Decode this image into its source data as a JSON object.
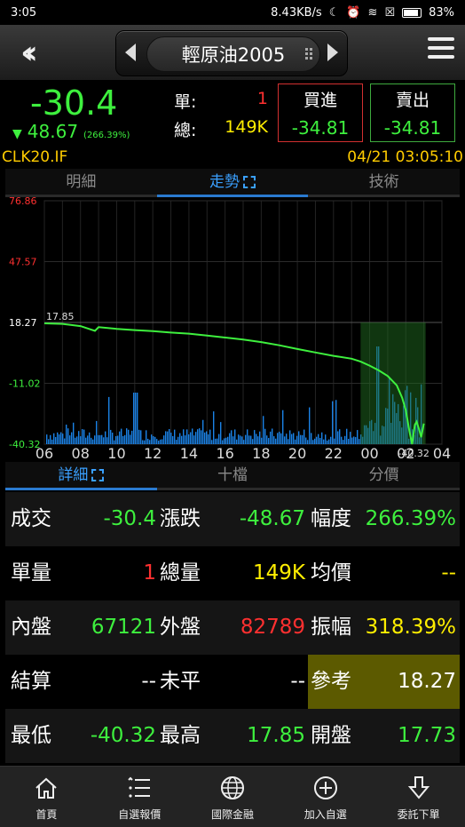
{
  "status_bar": {
    "time": "3:05",
    "network_speed": "8.43KB/s",
    "battery": "83%"
  },
  "nav": {
    "title": "輕原油2005"
  },
  "quote": {
    "last": "-30.4",
    "change": "48.67",
    "change_pct": "(266.39%)",
    "unit_label": "單:",
    "unit_value": "1",
    "total_label": "總:",
    "total_value": "149K",
    "buy_label": "買進",
    "buy_value": "-34.81",
    "sell_label": "賣出",
    "sell_value": "-34.81"
  },
  "info": {
    "code": "CLK20.IF",
    "datetime": "04/21 03:05:10"
  },
  "top_tabs": [
    "明細",
    "走勢",
    "技術"
  ],
  "chart_data": {
    "type": "line",
    "y_ticks": [
      "76.86",
      "47.57",
      "18.27",
      "-11.02",
      "-40.32"
    ],
    "y_tick_colors": [
      "#ff3030",
      "#ff3030",
      "#ffffff",
      "#3ef03e",
      "#3ef03e"
    ],
    "x_ticks": [
      "06",
      "08",
      "10",
      "12",
      "14",
      "16",
      "18",
      "20",
      "22",
      "00",
      "02",
      "04"
    ],
    "ylim": [
      -40.32,
      76.86
    ],
    "reference": 18.27,
    "high_label": "17.85",
    "low_label": "-40.32",
    "price": {
      "x": [
        0,
        1,
        2,
        2.8,
        3,
        4,
        5,
        6,
        7,
        8,
        9,
        10,
        11,
        12,
        13,
        14,
        15,
        16,
        17,
        17.5,
        18,
        18.5,
        19,
        19.5,
        19.8,
        20,
        20.2,
        20.35,
        20.5,
        20.6,
        20.75,
        20.85,
        21.0
      ],
      "y": [
        17.85,
        17.6,
        16.5,
        14.2,
        16.0,
        15.2,
        14.6,
        14.1,
        13.4,
        12.9,
        12.0,
        11.0,
        10.0,
        8.8,
        7.3,
        5.5,
        3.8,
        2.2,
        0.8,
        -0.6,
        -2.5,
        -4.8,
        -7.5,
        -12.0,
        -18.0,
        -24.0,
        -34.0,
        -40.32,
        -31.0,
        -29.5,
        -33.5,
        -37.0,
        -30.4
      ]
    },
    "volume_color": "#1e90ff",
    "line_color": "#3ef03e"
  },
  "detail_tabs": [
    "詳細",
    "十檔",
    "分價"
  ],
  "detail": {
    "rows": [
      [
        {
          "label": "成交",
          "value": "-30.4",
          "color": "#3ef03e"
        },
        {
          "label": "漲跌",
          "value": "-48.67",
          "color": "#3ef03e"
        },
        {
          "label": "幅度",
          "value": "266.39%",
          "color": "#3ef03e"
        }
      ],
      [
        {
          "label": "單量",
          "value": "1",
          "color": "#ff3030"
        },
        {
          "label": "總量",
          "value": "149K",
          "color": "#ffee00"
        },
        {
          "label": "均價",
          "value": "--",
          "color": "#ffee00"
        }
      ],
      [
        {
          "label": "內盤",
          "value": "67121",
          "color": "#3ef03e"
        },
        {
          "label": "外盤",
          "value": "82789",
          "color": "#ff3030"
        },
        {
          "label": "振幅",
          "value": "318.39%",
          "color": "#ffee00"
        }
      ],
      [
        {
          "label": "結算",
          "value": "--",
          "color": "#ffffff"
        },
        {
          "label": "未平",
          "value": "--",
          "color": "#ffffff"
        },
        {
          "label": "參考",
          "value": "18.27",
          "color": "#ffffff"
        }
      ],
      [
        {
          "label": "最低",
          "value": "-40.32",
          "color": "#3ef03e"
        },
        {
          "label": "最高",
          "value": "17.85",
          "color": "#3ef03e"
        },
        {
          "label": "開盤",
          "value": "17.73",
          "color": "#3ef03e"
        }
      ]
    ]
  },
  "bottom_nav": [
    {
      "label": "首頁",
      "icon": "home-icon"
    },
    {
      "label": "自選報價",
      "icon": "list-star-icon"
    },
    {
      "label": "國際金融",
      "icon": "globe-icon"
    },
    {
      "label": "加入自選",
      "icon": "plus-circle-icon"
    },
    {
      "label": "委託下單",
      "icon": "download-arrow-icon"
    }
  ]
}
